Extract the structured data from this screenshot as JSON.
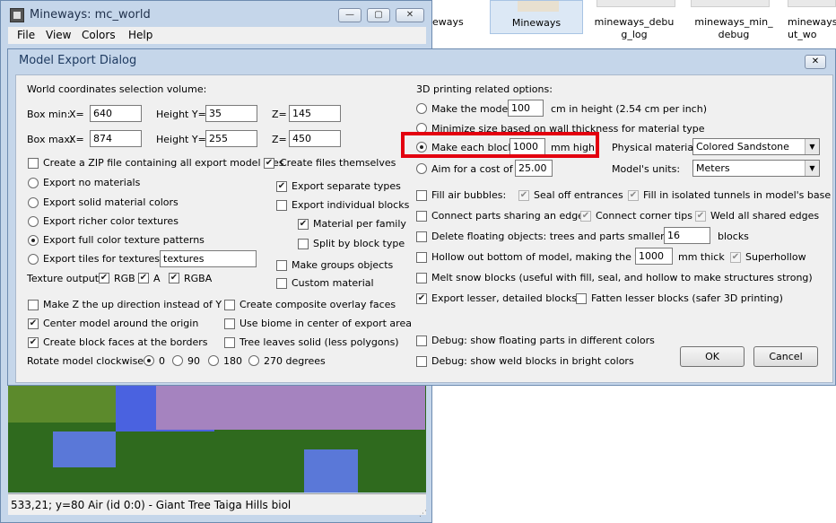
{
  "explorer": {
    "tiles": [
      {
        "label": "eways"
      },
      {
        "label": "Mineways"
      },
      {
        "label": "mineways_debu g_log"
      },
      {
        "label": "mineways_min_ debug"
      },
      {
        "label": "mineways ut_wo"
      }
    ]
  },
  "main_window": {
    "title": "Mineways: mc_world",
    "controls": {
      "minimize": "—",
      "maximize": "▢",
      "close": "✕"
    },
    "menu": [
      "File",
      "View",
      "Colors",
      "Help"
    ],
    "status": "533,21; y=80 Air (id 0:0) - Giant Tree Taiga Hills biol"
  },
  "dialog": {
    "title": "Model Export Dialog",
    "close": "✕",
    "left": {
      "section_label": "World coordinates selection volume:",
      "box_min": {
        "label": "Box min:",
        "x_label": "X=",
        "x": "640",
        "y_label": "Height Y=",
        "y": "35",
        "z_label": "Z=",
        "z": "145"
      },
      "box_max": {
        "label": "Box max:",
        "x_label": "X=",
        "x": "874",
        "y_label": "Height Y=",
        "y": "255",
        "z_label": "Z=",
        "z": "450"
      },
      "zip": {
        "label": "Create a ZIP file containing all export model files",
        "checked": false
      },
      "create_files": {
        "label": "Create files themselves",
        "checked": true
      },
      "export_options": [
        {
          "label": "Export no materials",
          "selected": false
        },
        {
          "label": "Export solid material colors",
          "selected": false
        },
        {
          "label": "Export richer color textures",
          "selected": false
        },
        {
          "label": "Export full color texture patterns",
          "selected": true
        },
        {
          "label": "Export tiles for textures to",
          "selected": false
        }
      ],
      "tiles_folder": "textures",
      "separate_types": {
        "label": "Export separate types",
        "checked": true
      },
      "individual_blocks": {
        "label": "Export individual blocks",
        "checked": false
      },
      "material_per_family": {
        "label": "Material per family",
        "checked": true
      },
      "split_by_block_type": {
        "label": "Split by block type",
        "checked": false
      },
      "make_groups": {
        "label": "Make groups objects",
        "checked": false
      },
      "custom_material": {
        "label": "Custom material",
        "checked": false
      },
      "texture_output": {
        "label": "Texture output:",
        "rgb": "RGB",
        "a": "A",
        "rgba": "RGBA"
      },
      "z_up": {
        "label": "Make Z the up direction instead of Y",
        "checked": false
      },
      "center_model": {
        "label": "Center model around the origin",
        "checked": true
      },
      "block_faces": {
        "label": "Create block faces at the borders",
        "checked": true
      },
      "composite_overlay": {
        "label": "Create composite overlay faces",
        "checked": false
      },
      "use_biome": {
        "label": "Use biome in center of export area",
        "checked": false
      },
      "tree_leaves": {
        "label": "Tree leaves solid (less polygons)",
        "checked": false
      },
      "rotate": {
        "label": "Rotate model clockwise:",
        "options": [
          "0",
          "90",
          "180",
          "270 degrees"
        ],
        "selected": "0"
      }
    },
    "right": {
      "section_label": "3D printing related options:",
      "make_model": {
        "label": "Make the model",
        "value": "100",
        "suffix": "cm in height (2.54 cm per inch)"
      },
      "minimize": {
        "label": "Minimize size based on wall thickness for material type"
      },
      "make_block": {
        "label": "Make each block",
        "value": "1000",
        "suffix": "mm high"
      },
      "aim_cost": {
        "label": "Aim for a cost of",
        "value": "25.00"
      },
      "physical_material": {
        "label": "Physical material:",
        "value": "Colored Sandstone"
      },
      "model_units": {
        "label": "Model's units:",
        "value": "Meters"
      },
      "fill_air": {
        "label": "Fill air bubbles:",
        "checked": false
      },
      "seal_entrances": {
        "label": "Seal off entrances",
        "checked": true
      },
      "fill_tunnels": {
        "label": "Fill in isolated tunnels in model's base",
        "checked": true
      },
      "connect_parts": {
        "label": "Connect parts sharing an edge:",
        "checked": false
      },
      "connect_corner": {
        "label": "Connect corner tips",
        "checked": true
      },
      "weld_edges": {
        "label": "Weld all shared edges",
        "checked": true
      },
      "delete_floating": {
        "label": "Delete floating objects: trees and parts smaller than",
        "value": "16",
        "suffix": "blocks"
      },
      "hollow": {
        "label": "Hollow out bottom of model, making the walls",
        "value": "1000",
        "suffix": "mm thick"
      },
      "superhollow": {
        "label": "Superhollow",
        "checked": true
      },
      "melt_snow": {
        "label": "Melt snow blocks (useful with fill, seal, and hollow to make structures strong)",
        "checked": false
      },
      "export_lesser": {
        "label": "Export lesser, detailed blocks:",
        "checked": true
      },
      "fatten_lesser": {
        "label": "Fatten lesser blocks (safer 3D printing)",
        "checked": false
      },
      "debug_floating": {
        "label": "Debug: show floating parts in different colors",
        "checked": false
      },
      "debug_weld": {
        "label": "Debug: show weld blocks in bright colors",
        "checked": false
      }
    },
    "ok_label": "OK",
    "cancel_label": "Cancel"
  },
  "colors": {
    "highlight": "#e3000f"
  }
}
